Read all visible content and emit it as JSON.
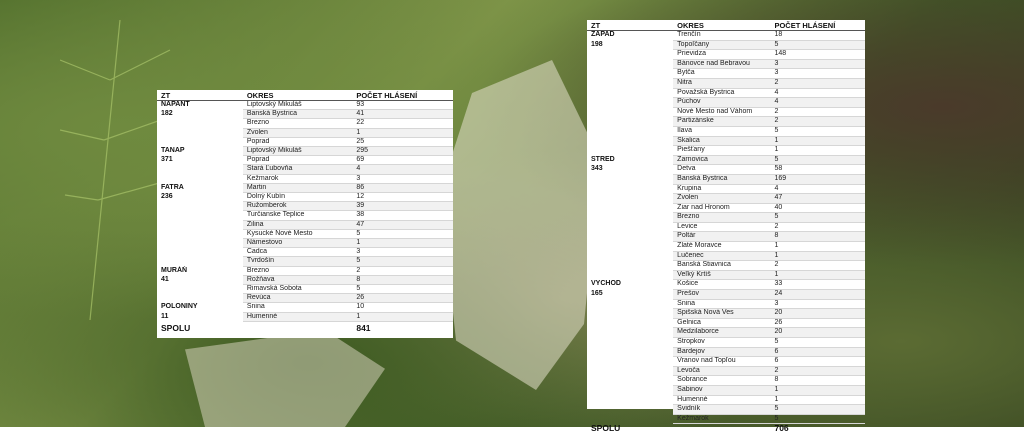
{
  "headers": {
    "zt": "ZT",
    "okres": "OKRES",
    "pocet": "POČET HLÁSENÍ"
  },
  "left": {
    "groups": [
      {
        "name": "NAPANT",
        "total": "182",
        "rows": [
          [
            "Liptovský Mikuláš",
            "93"
          ],
          [
            "Banská Bystrica",
            "41"
          ],
          [
            "Brezno",
            "22"
          ],
          [
            "Zvolen",
            "1"
          ],
          [
            "Poprad",
            "25"
          ]
        ]
      },
      {
        "name": "TANAP",
        "total": "371",
        "rows": [
          [
            "Liptovský Mikuláš",
            "295"
          ],
          [
            "Poprad",
            "69"
          ],
          [
            "Stará Ľubovňa",
            "4"
          ],
          [
            "Kežmarok",
            "3"
          ]
        ]
      },
      {
        "name": "FATRA",
        "total": "236",
        "rows": [
          [
            "Martin",
            "86"
          ],
          [
            "Dolný Kubín",
            "12"
          ],
          [
            "Ružomberok",
            "39"
          ],
          [
            "Turčianske Teplice",
            "38"
          ],
          [
            "Žilina",
            "47"
          ],
          [
            "Kysucké Nové Mesto",
            "5"
          ],
          [
            "Námestovo",
            "1"
          ],
          [
            "Čadca",
            "3"
          ],
          [
            "Tvrdošín",
            "5"
          ]
        ]
      },
      {
        "name": "MURÁŇ",
        "total": "41",
        "rows": [
          [
            "Brezno",
            "2"
          ],
          [
            "Rožňava",
            "8"
          ],
          [
            "Rimavská Sobota",
            "5"
          ],
          [
            "Revúca",
            "26"
          ]
        ]
      },
      {
        "name": "POLONINY",
        "total": "11",
        "rows": [
          [
            "Snina",
            "10"
          ],
          [
            "Humenné",
            "1"
          ]
        ]
      }
    ],
    "spolu_label": "SPOLU",
    "spolu_value": "841"
  },
  "right": {
    "groups": [
      {
        "name": "ZÁPAD",
        "total": "198",
        "rows": [
          [
            "Trenčín",
            "18"
          ],
          [
            "Topoľčany",
            "5"
          ],
          [
            "Prievidza",
            "148"
          ],
          [
            "Bánovce nad Bebravou",
            "3"
          ],
          [
            "Bytča",
            "3"
          ],
          [
            "Nitra",
            "2"
          ],
          [
            "Považská Bystrica",
            "4"
          ],
          [
            "Púchov",
            "4"
          ],
          [
            "Nové Mesto nad Váhom",
            "2"
          ],
          [
            "Partizánske",
            "2"
          ],
          [
            "Ilava",
            "5"
          ],
          [
            "Skalica",
            "1"
          ],
          [
            "Piešťany",
            "1"
          ]
        ]
      },
      {
        "name": "STRED",
        "total": "343",
        "rows": [
          [
            "Žarnovica",
            "5"
          ],
          [
            "Detva",
            "58"
          ],
          [
            "Banská Bystrica",
            "169"
          ],
          [
            "Krupina",
            "4"
          ],
          [
            "Zvolen",
            "47"
          ],
          [
            "Žiar nad Hronom",
            "40"
          ],
          [
            "Brezno",
            "5"
          ],
          [
            "Levice",
            "2"
          ],
          [
            "Poltár",
            "8"
          ],
          [
            "Zlaté Moravce",
            "1"
          ],
          [
            "Lučenec",
            "1"
          ],
          [
            "Banská Štiavnica",
            "2"
          ],
          [
            "Veľký Krtíš",
            "1"
          ]
        ]
      },
      {
        "name": "VÝCHOD",
        "total": "165",
        "rows": [
          [
            "Košice",
            "33"
          ],
          [
            "Prešov",
            "24"
          ],
          [
            "Snina",
            "3"
          ],
          [
            "Spišská Nová Ves",
            "20"
          ],
          [
            "Gelnica",
            "26"
          ],
          [
            "Medzilaborce",
            "20"
          ],
          [
            "Stropkov",
            "5"
          ],
          [
            "Bardejov",
            "6"
          ],
          [
            "Vranov nad Topľou",
            "6"
          ],
          [
            "Levoča",
            "2"
          ],
          [
            "Sobrance",
            "8"
          ],
          [
            "Sabinov",
            "1"
          ],
          [
            "Humenné",
            "1"
          ],
          [
            "Svidník",
            "5"
          ],
          [
            "Kežmarok",
            "5"
          ]
        ]
      }
    ],
    "spolu_label": "SPOLU",
    "spolu_value": "706"
  }
}
